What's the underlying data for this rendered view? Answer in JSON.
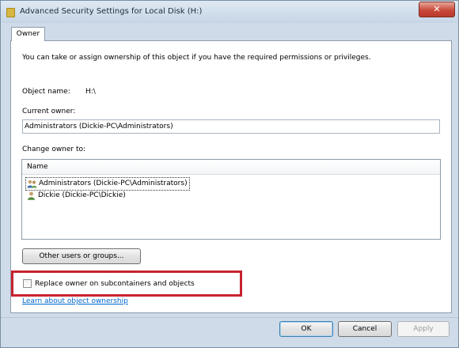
{
  "window": {
    "title": "Advanced Security Settings for Local Disk (H:)",
    "close_label": "✕"
  },
  "tabs": [
    {
      "label": "Owner",
      "selected": true
    }
  ],
  "owner_tab": {
    "description": "You can take or assign ownership of this object if you have the required permissions or privileges.",
    "object_name_label": "Object name:",
    "object_name_value": "H:\\",
    "current_owner_label": "Current owner:",
    "current_owner_value": "Administrators (Dickie-PC\\Administrators)",
    "change_owner_label": "Change owner to:",
    "list": {
      "column_header": "Name",
      "items": [
        {
          "label": "Administrators (Dickie-PC\\Administrators)",
          "icon": "user-group-icon",
          "selected": true
        },
        {
          "label": "Dickie (Dickie-PC\\Dickie)",
          "icon": "user-icon",
          "selected": false
        }
      ]
    },
    "other_users_button": "Other users or groups...",
    "replace_owner_checkbox": {
      "label": "Replace owner on subcontainers and objects",
      "checked": false
    },
    "learn_link": "Learn about object ownership"
  },
  "footer": {
    "ok_label": "OK",
    "cancel_label": "Cancel",
    "apply_label": "Apply",
    "apply_enabled": false
  },
  "colors": {
    "highlight_box": "#c8232f",
    "link": "#0066cc",
    "window_frame": "#cfdbe8"
  }
}
